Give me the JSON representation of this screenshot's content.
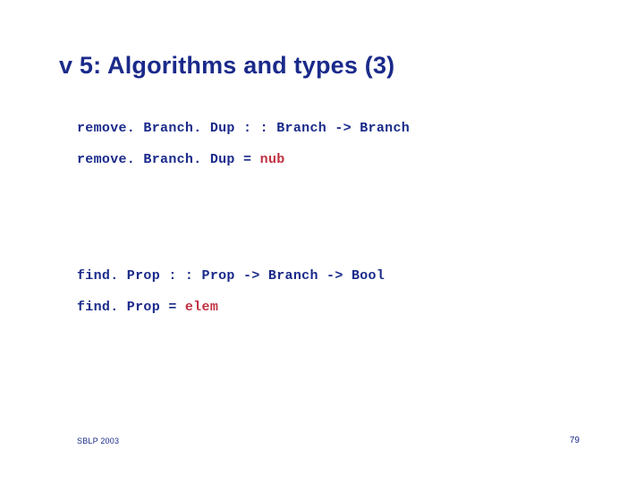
{
  "title": "v 5: Algorithms and types (3)",
  "code": {
    "line1_a": "remove. Branch. Dup : : Branch -> Branch",
    "line2_a": "remove. Branch. Dup = ",
    "line2_hl": "nub",
    "line3_a": "find. Prop : : Prop -> Branch -> Bool",
    "line4_a": "find. Prop = ",
    "line4_hl": "elem"
  },
  "footer": {
    "left": "SBLP 2003",
    "right": "79"
  }
}
